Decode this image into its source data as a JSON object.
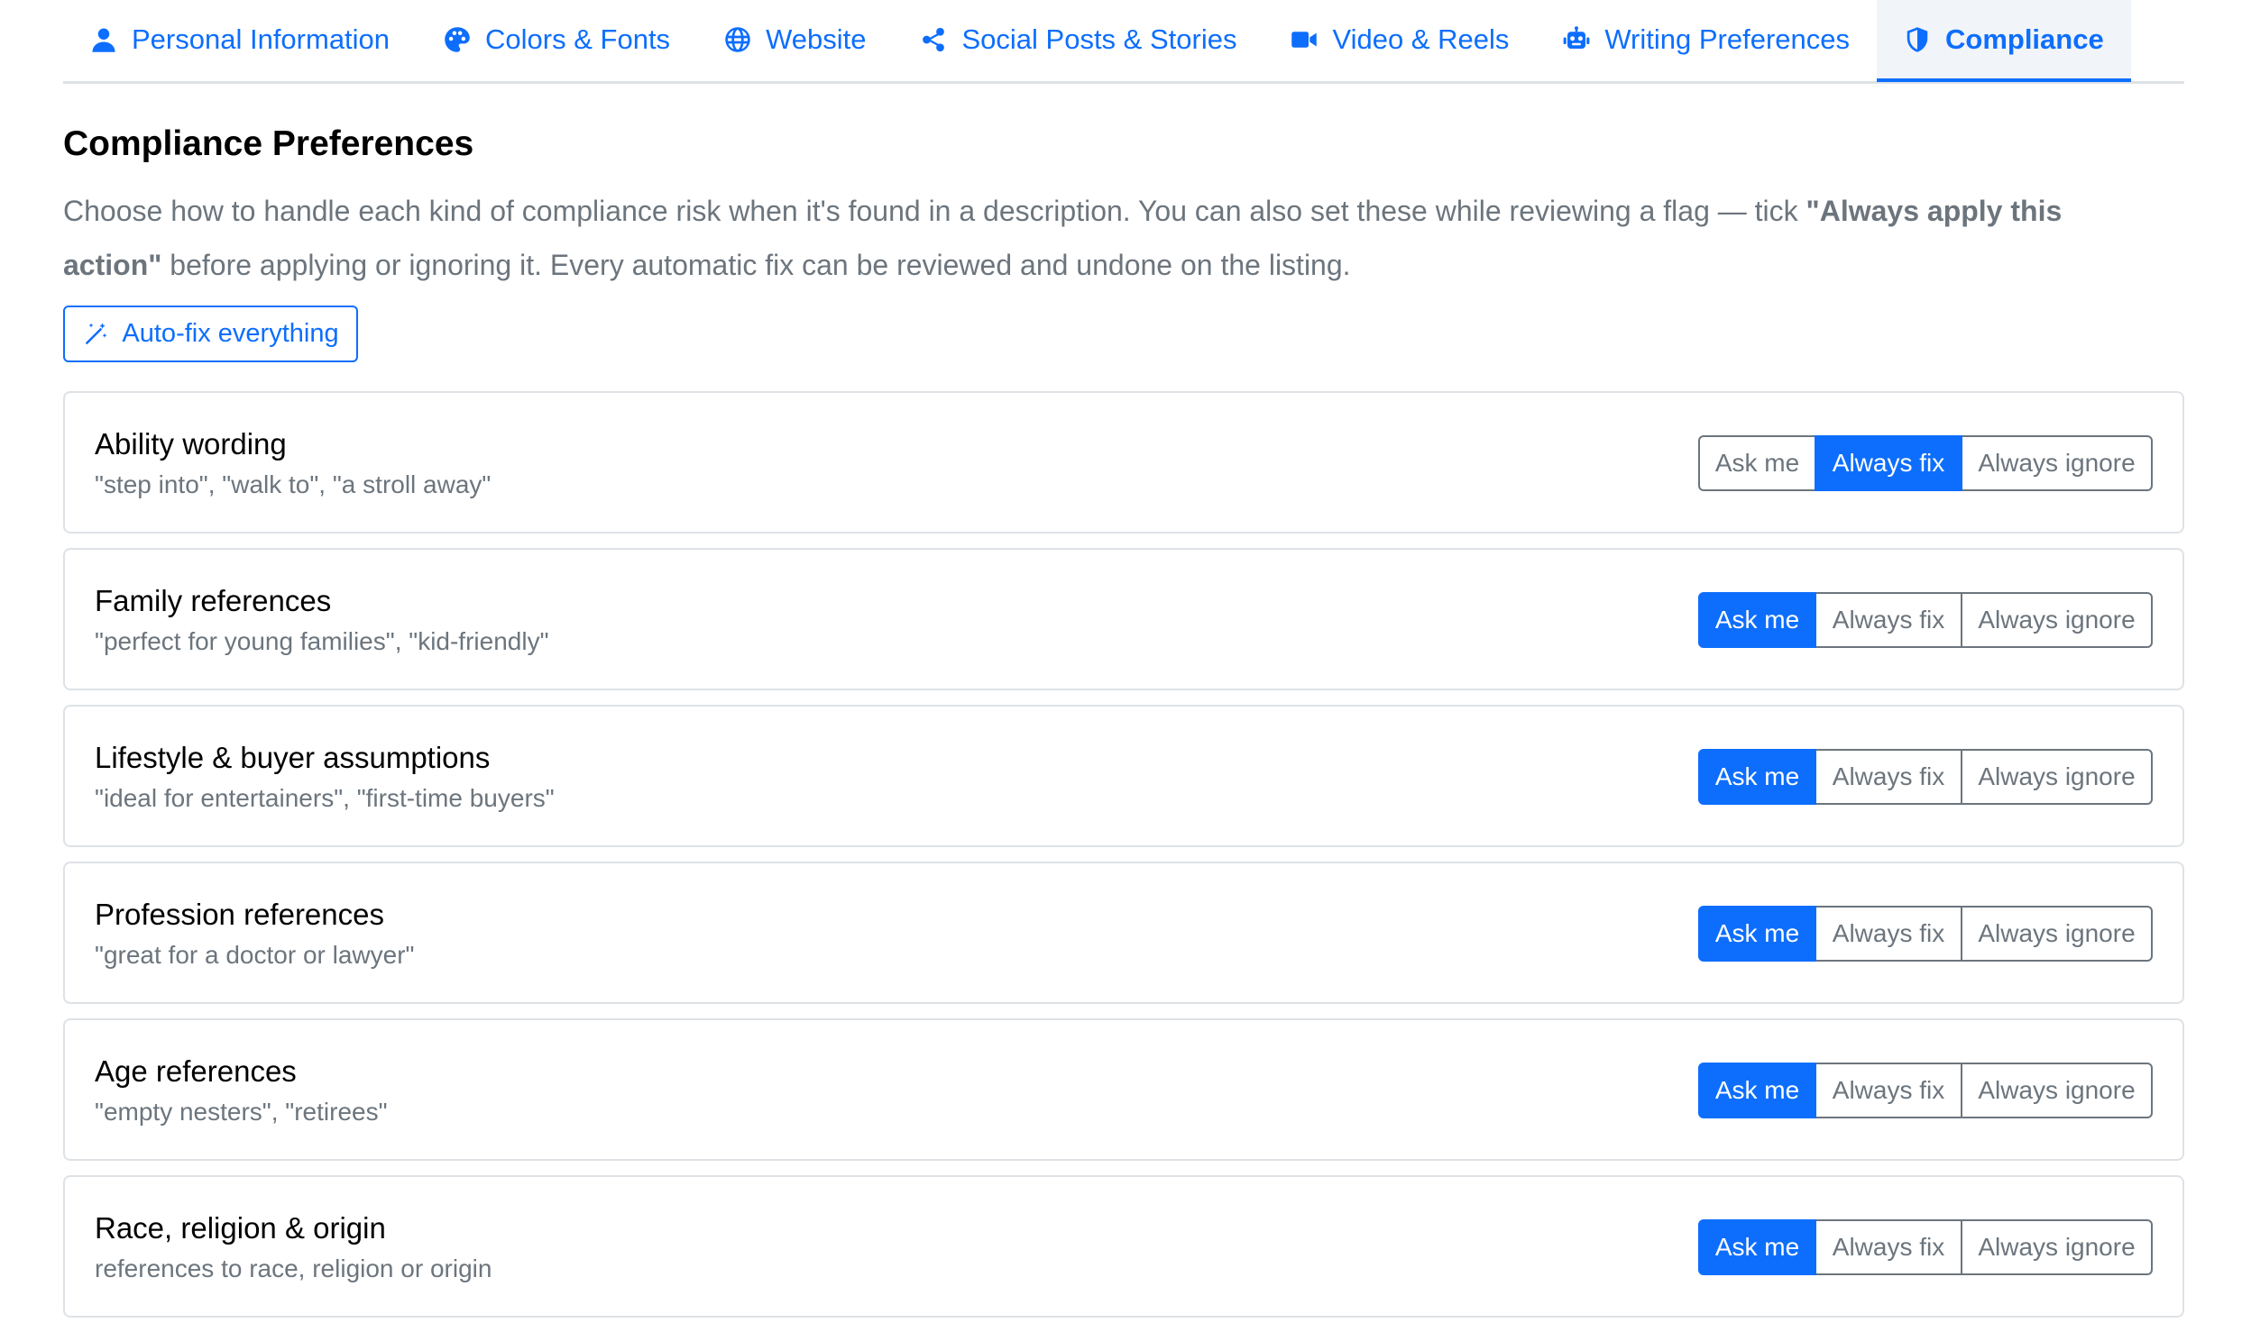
{
  "tabs": [
    {
      "label": "Personal Information",
      "icon": "user-icon",
      "active": false
    },
    {
      "label": "Colors & Fonts",
      "icon": "palette-icon",
      "active": false
    },
    {
      "label": "Website",
      "icon": "globe-icon",
      "active": false
    },
    {
      "label": "Social Posts & Stories",
      "icon": "share-icon",
      "active": false
    },
    {
      "label": "Video & Reels",
      "icon": "video-icon",
      "active": false
    },
    {
      "label": "Writing Preferences",
      "icon": "robot-icon",
      "active": false
    },
    {
      "label": "Compliance",
      "icon": "shield-icon",
      "active": true
    }
  ],
  "page": {
    "title": "Compliance Preferences",
    "intro_part1": "Choose how to handle each kind of compliance risk when it's found in a description. You can also set these while reviewing a flag — tick ",
    "intro_bold": "\"Always apply this action\"",
    "intro_part2": " before applying or ignoring it. Every automatic fix can be reviewed and undone on the listing.",
    "autofix_label": "Auto-fix everything"
  },
  "options": {
    "ask": "Ask me",
    "fix": "Always fix",
    "ignore": "Always ignore"
  },
  "categories": [
    {
      "title": "Ability wording",
      "desc": "\"step into\", \"walk to\", \"a stroll away\"",
      "selected": "fix"
    },
    {
      "title": "Family references",
      "desc": "\"perfect for young families\", \"kid-friendly\"",
      "selected": "ask"
    },
    {
      "title": "Lifestyle & buyer assumptions",
      "desc": "\"ideal for entertainers\", \"first-time buyers\"",
      "selected": "ask"
    },
    {
      "title": "Profession references",
      "desc": "\"great for a doctor or lawyer\"",
      "selected": "ask"
    },
    {
      "title": "Age references",
      "desc": "\"empty nesters\", \"retirees\"",
      "selected": "ask"
    },
    {
      "title": "Race, religion & origin",
      "desc": "references to race, religion or origin",
      "selected": "ask"
    }
  ],
  "colors": {
    "accent": "#0d6efd",
    "muted": "#6c757d",
    "border": "#dee2e6",
    "active_tab_bg": "#f1f4f8"
  }
}
